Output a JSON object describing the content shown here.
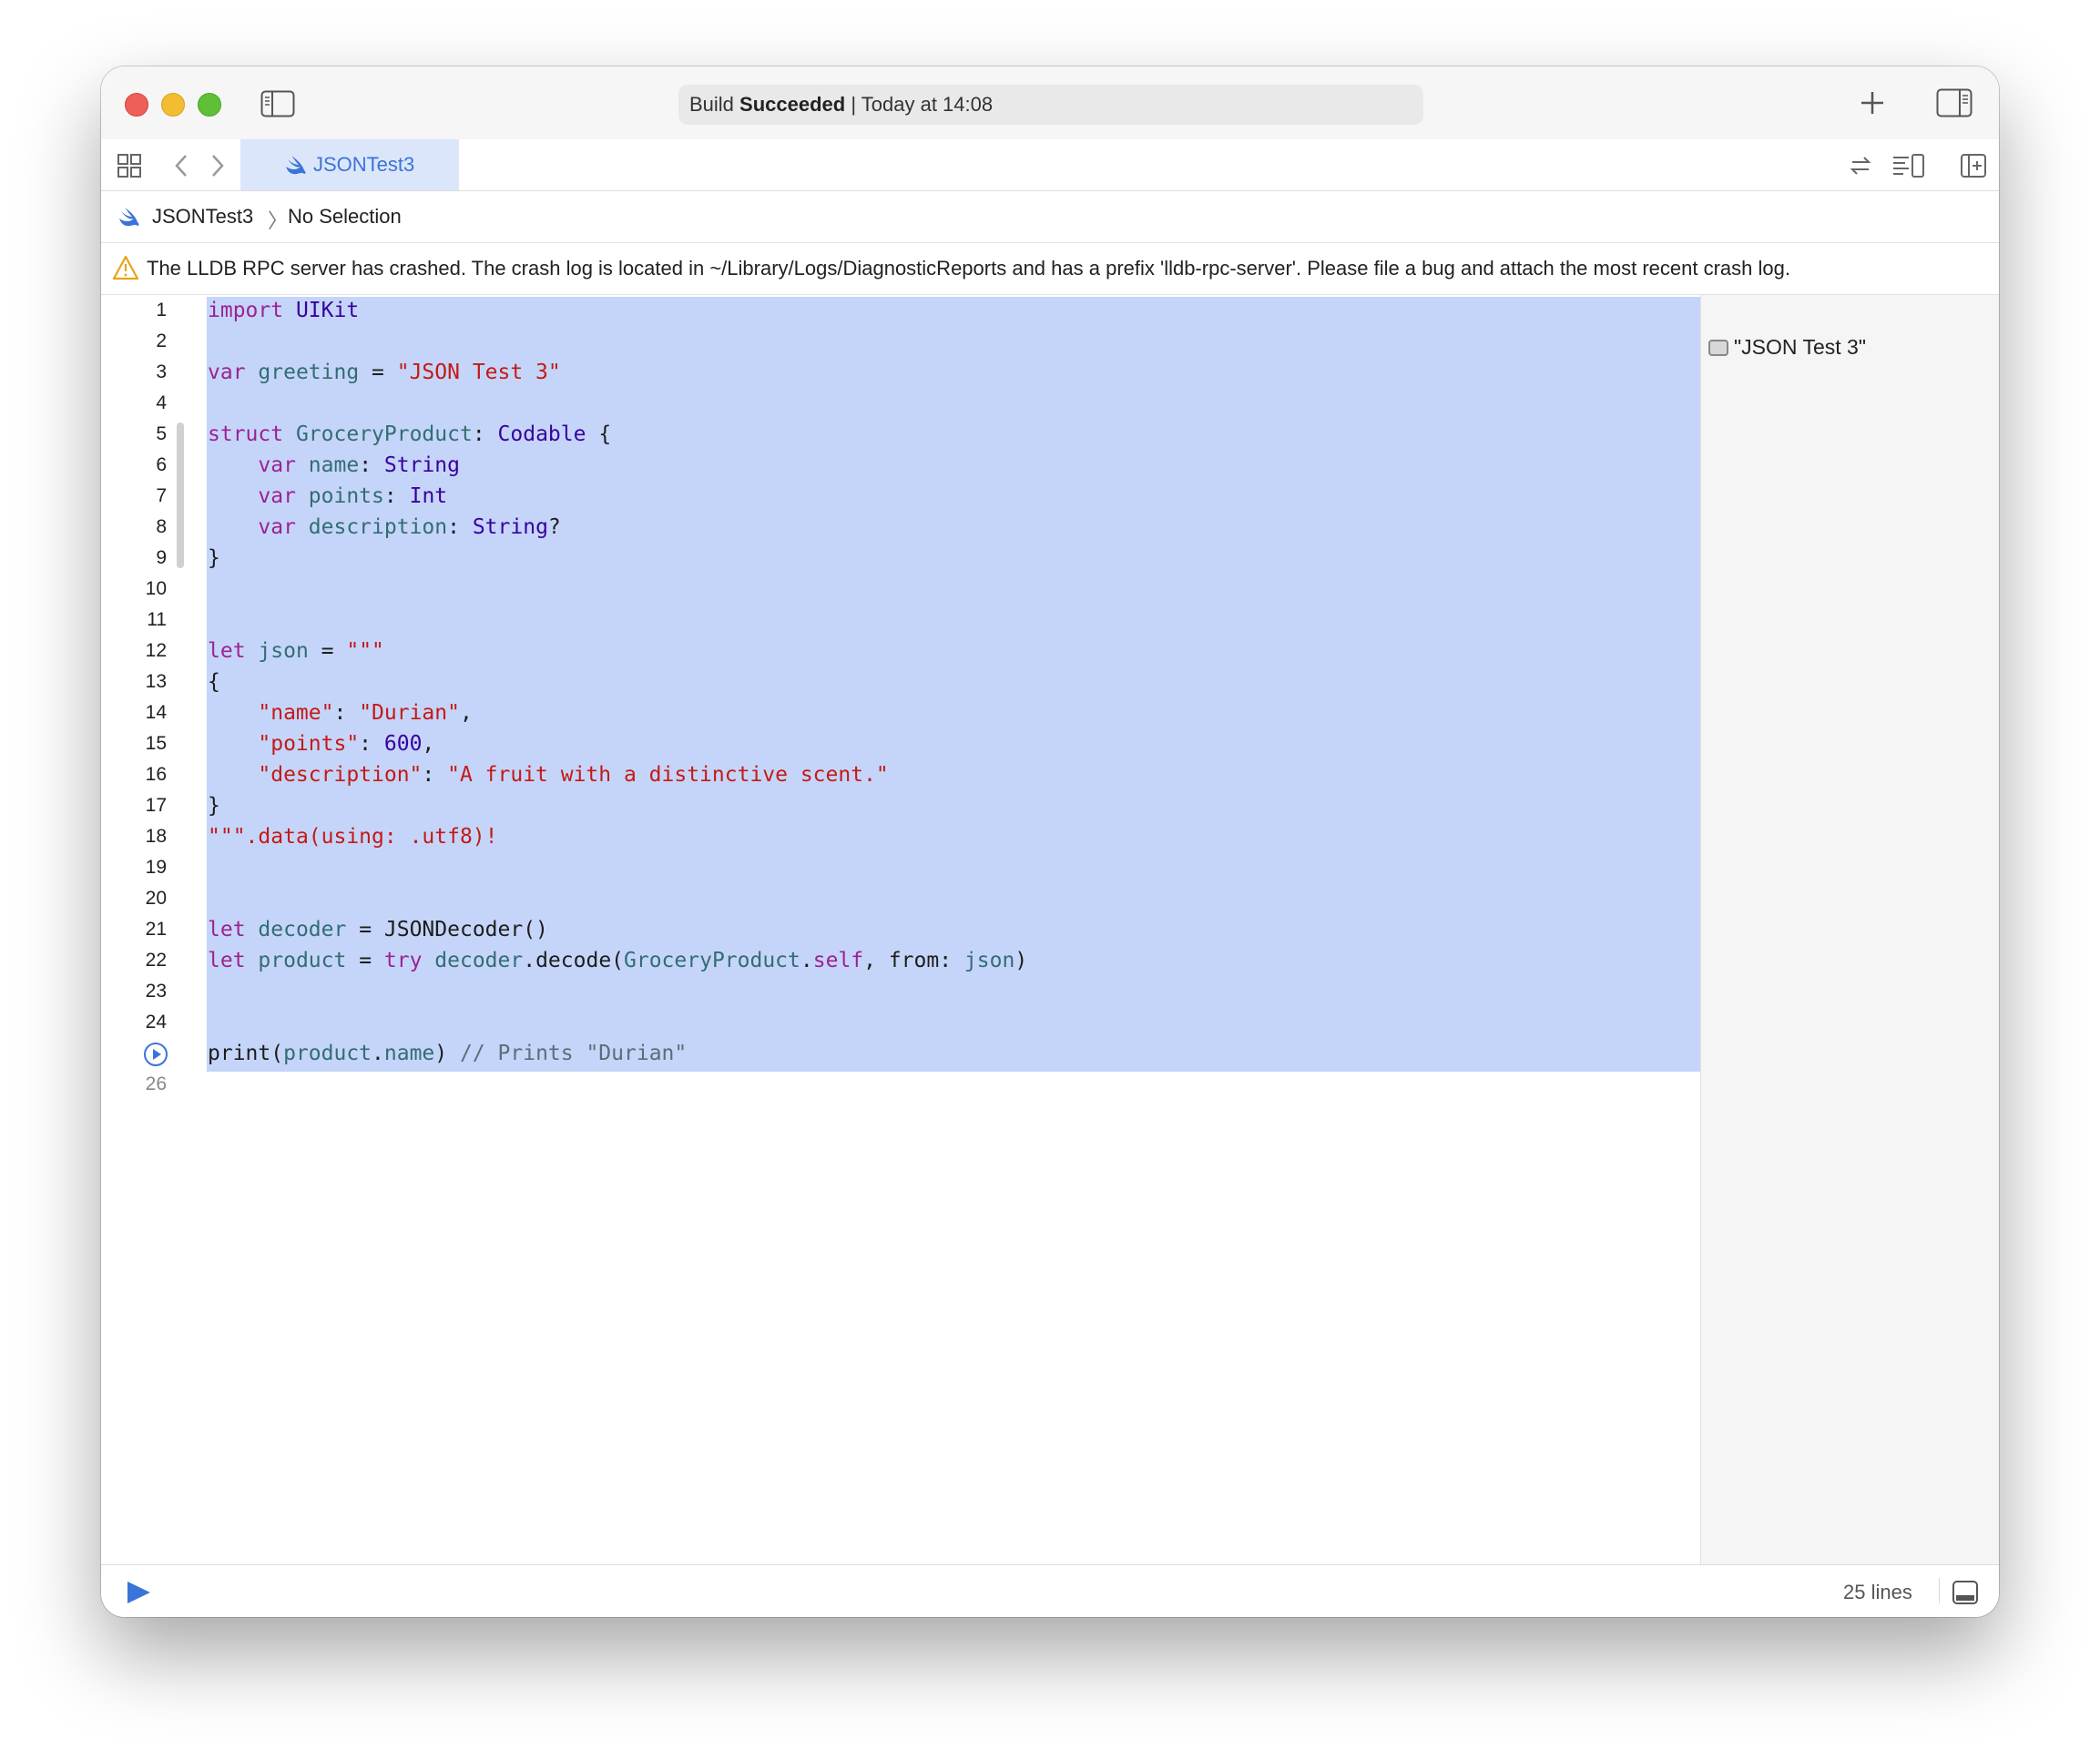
{
  "titlebar": {
    "status_prefix": "Build ",
    "status_bold": "Succeeded",
    "status_suffix": " | Today at 14:08"
  },
  "tabbar": {
    "active_tab": "JSONTest3"
  },
  "jumpbar": {
    "file": "JSONTest3",
    "separator": "〉",
    "selection": "No Selection"
  },
  "warning": {
    "text": "The LLDB RPC server has crashed. The crash log is located in ~/Library/Logs/DiagnosticReports and has a prefix 'lldb-rpc-server'. Please file a bug and attach the most recent crash log."
  },
  "editor": {
    "line_numbers": [
      "1",
      "2",
      "3",
      "4",
      "5",
      "6",
      "7",
      "8",
      "9",
      "10",
      "11",
      "12",
      "13",
      "14",
      "15",
      "16",
      "17",
      "18",
      "19",
      "20",
      "21",
      "22",
      "23",
      "24",
      "",
      "26"
    ],
    "code": {
      "l1": "import UIKit",
      "l3": "var greeting = \"JSON Test 3\"",
      "l5": "struct GroceryProduct: Codable {",
      "l6": "    var name: String",
      "l7": "    var points: Int",
      "l8": "    var description: String?",
      "l9": "}",
      "l12": "let json = \"\"\"",
      "l13": "{",
      "l14": "    \"name\": \"Durian\",",
      "l15": "    \"points\": 600,",
      "l16": "    \"description\": \"A fruit with a distinctive scent.\"",
      "l17": "}",
      "l18": "\"\"\".data(using: .utf8)!",
      "l21": "let decoder = JSONDecoder()",
      "l22": "let product = try decoder.decode(GroceryProduct.self, from: json)",
      "l25": "print(product.name) // Prints \"Durian\""
    }
  },
  "results": {
    "greeting_value": "\"JSON Test 3\""
  },
  "bottombar": {
    "lines_count": "25 lines"
  },
  "colors": {
    "selection": "#c5d5f9",
    "keyword": "#9b2393",
    "string": "#c41a16",
    "type": "#3900a0",
    "variable": "#326d74",
    "comment": "#5d6c79",
    "accent": "#3a74d8"
  },
  "icons": [
    "close-button",
    "minimize-button",
    "zoom-button",
    "sidebar-toggle-icon",
    "plus-icon",
    "inspector-toggle-icon",
    "grid-icon",
    "chevron-left-icon",
    "chevron-right-icon",
    "swift-icon",
    "swap-icon",
    "minimap-icon",
    "add-editor-icon",
    "warning-icon",
    "run-marker-icon",
    "play-icon",
    "console-toggle-icon"
  ]
}
